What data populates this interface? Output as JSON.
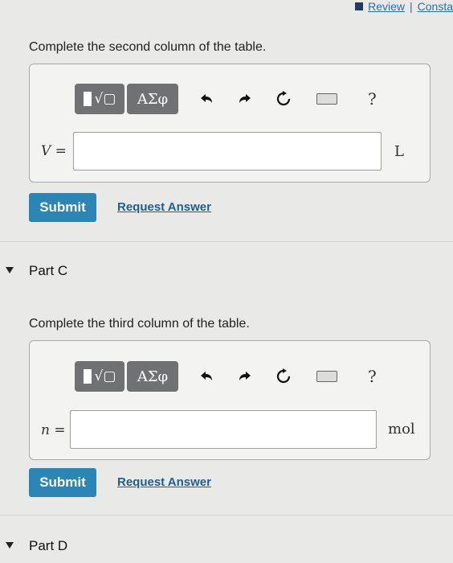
{
  "topbar": {
    "review": "Review",
    "separator": "|",
    "constants": "Consta"
  },
  "part_b": {
    "prompt": "Complete the second column of the table.",
    "var_label": "V",
    "equals": " =",
    "unit": "L",
    "submit": "Submit",
    "request": "Request Answer"
  },
  "part_c": {
    "heading": "Part C",
    "prompt": "Complete the third column of the table.",
    "var_label": "n",
    "equals": " =",
    "unit": "mol",
    "submit": "Submit",
    "request": "Request Answer"
  },
  "part_d": {
    "heading": "Part D"
  },
  "toolbar": {
    "greek": "ΑΣφ",
    "help": "?"
  }
}
